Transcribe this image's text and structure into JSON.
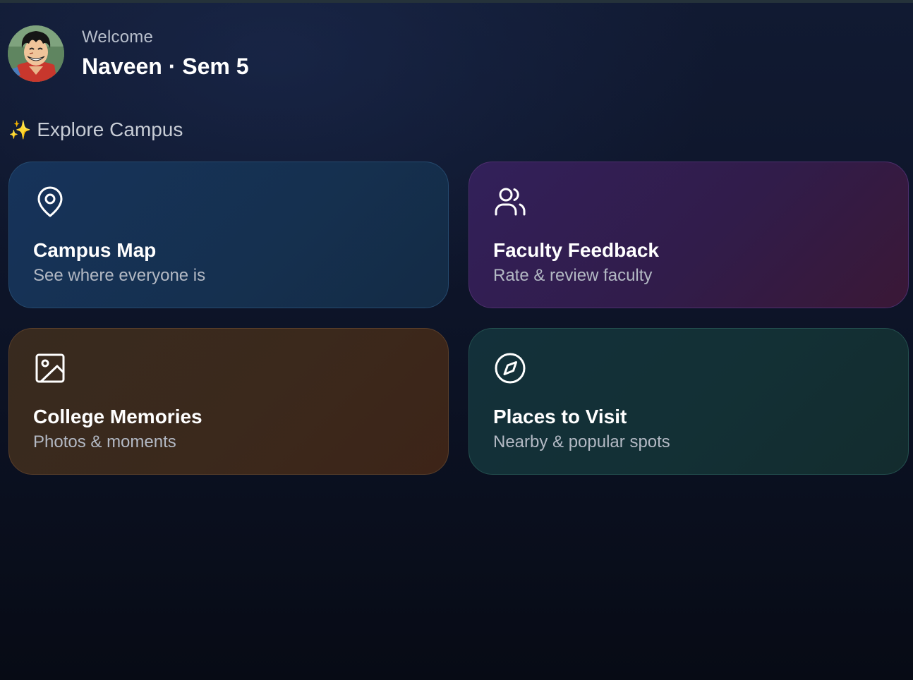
{
  "header": {
    "greeting": "Welcome",
    "user_line": "Naveen · Sem 5",
    "avatar_icon": "anime-avatar"
  },
  "section": {
    "emoji": "✨",
    "title": "Explore Campus"
  },
  "cards": [
    {
      "title": "Campus Map",
      "subtitle": "See where everyone is",
      "icon": "map-pin-icon",
      "color": "#16335a"
    },
    {
      "title": "Faculty Feedback",
      "subtitle": "Rate & review faculty",
      "icon": "users-icon",
      "color": "#32205a"
    },
    {
      "title": "College Memories",
      "subtitle": "Photos & moments",
      "icon": "image-icon",
      "color": "#3b291c"
    },
    {
      "title": "Places to Visit",
      "subtitle": "Nearby & popular spots",
      "icon": "compass-icon",
      "color": "#133035"
    }
  ],
  "colors": {
    "background": "#0d1428",
    "text_primary": "#ffffff",
    "text_secondary": "#b3b9c4"
  }
}
